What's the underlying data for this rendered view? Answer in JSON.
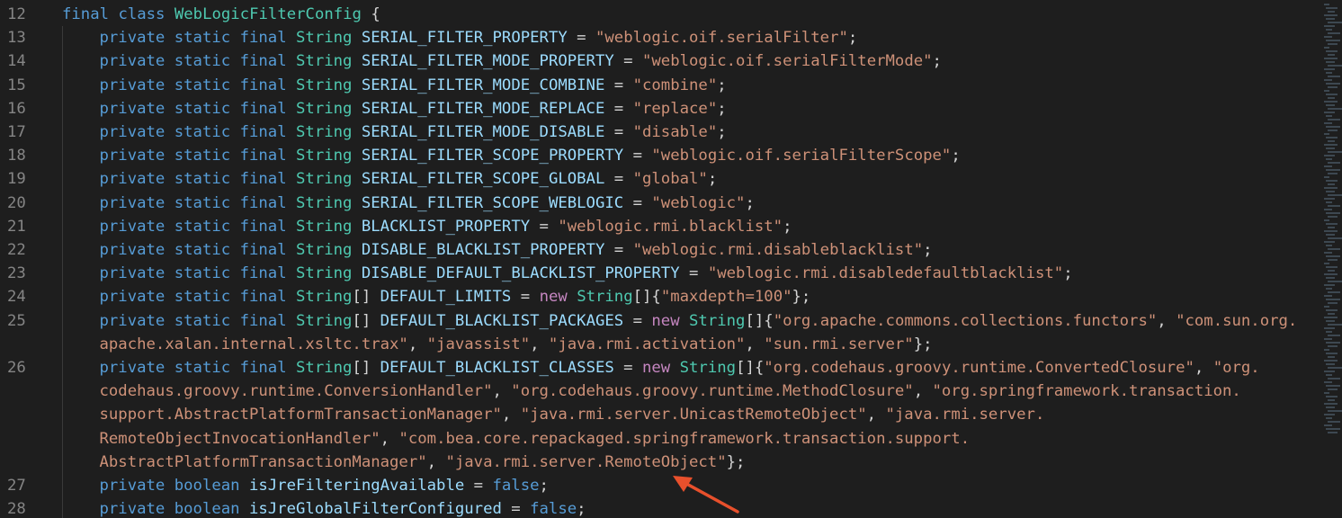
{
  "colors": {
    "background": "#1e1e1e",
    "keyword": "#569cd6",
    "type": "#4ec9b0",
    "string": "#ce9178",
    "identifier": "#9cdcfe",
    "new_keyword": "#c586c0",
    "arrow": "#e8502c"
  },
  "lines": [
    {
      "num": "12",
      "indent": 0,
      "tokens": [
        [
          "kw",
          "final "
        ],
        [
          "kw",
          "class "
        ],
        [
          "cl",
          "WebLogicFilterConfig"
        ],
        [
          "pn",
          " {"
        ]
      ]
    },
    {
      "num": "13",
      "indent": 1,
      "tokens": [
        [
          "kw",
          "private "
        ],
        [
          "kw",
          "static "
        ],
        [
          "kw",
          "final "
        ],
        [
          "ty",
          "String "
        ],
        [
          "id",
          "SERIAL_FILTER_PROPERTY"
        ],
        [
          "pn",
          " = "
        ],
        [
          "st",
          "\"weblogic.oif.serialFilter\""
        ],
        [
          "pn",
          ";"
        ]
      ]
    },
    {
      "num": "14",
      "indent": 1,
      "tokens": [
        [
          "kw",
          "private "
        ],
        [
          "kw",
          "static "
        ],
        [
          "kw",
          "final "
        ],
        [
          "ty",
          "String "
        ],
        [
          "id",
          "SERIAL_FILTER_MODE_PROPERTY"
        ],
        [
          "pn",
          " = "
        ],
        [
          "st",
          "\"weblogic.oif.serialFilterMode\""
        ],
        [
          "pn",
          ";"
        ]
      ]
    },
    {
      "num": "15",
      "indent": 1,
      "tokens": [
        [
          "kw",
          "private "
        ],
        [
          "kw",
          "static "
        ],
        [
          "kw",
          "final "
        ],
        [
          "ty",
          "String "
        ],
        [
          "id",
          "SERIAL_FILTER_MODE_COMBINE"
        ],
        [
          "pn",
          " = "
        ],
        [
          "st",
          "\"combine\""
        ],
        [
          "pn",
          ";"
        ]
      ]
    },
    {
      "num": "16",
      "indent": 1,
      "tokens": [
        [
          "kw",
          "private "
        ],
        [
          "kw",
          "static "
        ],
        [
          "kw",
          "final "
        ],
        [
          "ty",
          "String "
        ],
        [
          "id",
          "SERIAL_FILTER_MODE_REPLACE"
        ],
        [
          "pn",
          " = "
        ],
        [
          "st",
          "\"replace\""
        ],
        [
          "pn",
          ";"
        ]
      ]
    },
    {
      "num": "17",
      "indent": 1,
      "tokens": [
        [
          "kw",
          "private "
        ],
        [
          "kw",
          "static "
        ],
        [
          "kw",
          "final "
        ],
        [
          "ty",
          "String "
        ],
        [
          "id",
          "SERIAL_FILTER_MODE_DISABLE"
        ],
        [
          "pn",
          " = "
        ],
        [
          "st",
          "\"disable\""
        ],
        [
          "pn",
          ";"
        ]
      ]
    },
    {
      "num": "18",
      "indent": 1,
      "tokens": [
        [
          "kw",
          "private "
        ],
        [
          "kw",
          "static "
        ],
        [
          "kw",
          "final "
        ],
        [
          "ty",
          "String "
        ],
        [
          "id",
          "SERIAL_FILTER_SCOPE_PROPERTY"
        ],
        [
          "pn",
          " = "
        ],
        [
          "st",
          "\"weblogic.oif.serialFilterScope\""
        ],
        [
          "pn",
          ";"
        ]
      ]
    },
    {
      "num": "19",
      "indent": 1,
      "tokens": [
        [
          "kw",
          "private "
        ],
        [
          "kw",
          "static "
        ],
        [
          "kw",
          "final "
        ],
        [
          "ty",
          "String "
        ],
        [
          "id",
          "SERIAL_FILTER_SCOPE_GLOBAL"
        ],
        [
          "pn",
          " = "
        ],
        [
          "st",
          "\"global\""
        ],
        [
          "pn",
          ";"
        ]
      ]
    },
    {
      "num": "20",
      "indent": 1,
      "tokens": [
        [
          "kw",
          "private "
        ],
        [
          "kw",
          "static "
        ],
        [
          "kw",
          "final "
        ],
        [
          "ty",
          "String "
        ],
        [
          "id",
          "SERIAL_FILTER_SCOPE_WEBLOGIC"
        ],
        [
          "pn",
          " = "
        ],
        [
          "st",
          "\"weblogic\""
        ],
        [
          "pn",
          ";"
        ]
      ]
    },
    {
      "num": "21",
      "indent": 1,
      "tokens": [
        [
          "kw",
          "private "
        ],
        [
          "kw",
          "static "
        ],
        [
          "kw",
          "final "
        ],
        [
          "ty",
          "String "
        ],
        [
          "id",
          "BLACKLIST_PROPERTY"
        ],
        [
          "pn",
          " = "
        ],
        [
          "st",
          "\"weblogic.rmi.blacklist\""
        ],
        [
          "pn",
          ";"
        ]
      ]
    },
    {
      "num": "22",
      "indent": 1,
      "tokens": [
        [
          "kw",
          "private "
        ],
        [
          "kw",
          "static "
        ],
        [
          "kw",
          "final "
        ],
        [
          "ty",
          "String "
        ],
        [
          "id",
          "DISABLE_BLACKLIST_PROPERTY"
        ],
        [
          "pn",
          " = "
        ],
        [
          "st",
          "\"weblogic.rmi.disableblacklist\""
        ],
        [
          "pn",
          ";"
        ]
      ]
    },
    {
      "num": "23",
      "indent": 1,
      "tokens": [
        [
          "kw",
          "private "
        ],
        [
          "kw",
          "static "
        ],
        [
          "kw",
          "final "
        ],
        [
          "ty",
          "String "
        ],
        [
          "id",
          "DISABLE_DEFAULT_BLACKLIST_PROPERTY"
        ],
        [
          "pn",
          " = "
        ],
        [
          "st",
          "\"weblogic.rmi.disabledefaultblacklist\""
        ],
        [
          "pn",
          ";"
        ]
      ]
    },
    {
      "num": "24",
      "indent": 1,
      "tokens": [
        [
          "kw",
          "private "
        ],
        [
          "kw",
          "static "
        ],
        [
          "kw",
          "final "
        ],
        [
          "ty",
          "String"
        ],
        [
          "pn",
          "[] "
        ],
        [
          "id",
          "DEFAULT_LIMITS"
        ],
        [
          "pn",
          " = "
        ],
        [
          "nw",
          "new "
        ],
        [
          "ty",
          "String"
        ],
        [
          "pn",
          "[]{"
        ],
        [
          "st",
          "\"maxdepth=100\""
        ],
        [
          "pn",
          "};"
        ]
      ]
    },
    {
      "num": "25",
      "indent": 1,
      "tokens": [
        [
          "kw",
          "private "
        ],
        [
          "kw",
          "static "
        ],
        [
          "kw",
          "final "
        ],
        [
          "ty",
          "String"
        ],
        [
          "pn",
          "[] "
        ],
        [
          "id",
          "DEFAULT_BLACKLIST_PACKAGES"
        ],
        [
          "pn",
          " = "
        ],
        [
          "nw",
          "new "
        ],
        [
          "ty",
          "String"
        ],
        [
          "pn",
          "[]{"
        ],
        [
          "st",
          "\"org.apache.commons.collections.functors\""
        ],
        [
          "pn",
          ", "
        ],
        [
          "st",
          "\"com.sun.org."
        ]
      ]
    },
    {
      "num": "",
      "indent": 1,
      "tokens": [
        [
          "st",
          "apache.xalan.internal.xsltc.trax\""
        ],
        [
          "pn",
          ", "
        ],
        [
          "st",
          "\"javassist\""
        ],
        [
          "pn",
          ", "
        ],
        [
          "st",
          "\"java.rmi.activation\""
        ],
        [
          "pn",
          ", "
        ],
        [
          "st",
          "\"sun.rmi.server\""
        ],
        [
          "pn",
          "};"
        ]
      ]
    },
    {
      "num": "26",
      "indent": 1,
      "tokens": [
        [
          "kw",
          "private "
        ],
        [
          "kw",
          "static "
        ],
        [
          "kw",
          "final "
        ],
        [
          "ty",
          "String"
        ],
        [
          "pn",
          "[] "
        ],
        [
          "id",
          "DEFAULT_BLACKLIST_CLASSES"
        ],
        [
          "pn",
          " = "
        ],
        [
          "nw",
          "new "
        ],
        [
          "ty",
          "String"
        ],
        [
          "pn",
          "[]{"
        ],
        [
          "st",
          "\"org.codehaus.groovy.runtime.ConvertedClosure\""
        ],
        [
          "pn",
          ", "
        ],
        [
          "st",
          "\"org."
        ]
      ]
    },
    {
      "num": "",
      "indent": 1,
      "tokens": [
        [
          "st",
          "codehaus.groovy.runtime.ConversionHandler\""
        ],
        [
          "pn",
          ", "
        ],
        [
          "st",
          "\"org.codehaus.groovy.runtime.MethodClosure\""
        ],
        [
          "pn",
          ", "
        ],
        [
          "st",
          "\"org.springframework.transaction."
        ]
      ]
    },
    {
      "num": "",
      "indent": 1,
      "tokens": [
        [
          "st",
          "support.AbstractPlatformTransactionManager\""
        ],
        [
          "pn",
          ", "
        ],
        [
          "st",
          "\"java.rmi.server.UnicastRemoteObject\""
        ],
        [
          "pn",
          ", "
        ],
        [
          "st",
          "\"java.rmi.server."
        ]
      ]
    },
    {
      "num": "",
      "indent": 1,
      "tokens": [
        [
          "st",
          "RemoteObjectInvocationHandler\""
        ],
        [
          "pn",
          ", "
        ],
        [
          "st",
          "\"com.bea.core.repackaged.springframework.transaction.support."
        ]
      ]
    },
    {
      "num": "",
      "indent": 1,
      "tokens": [
        [
          "st",
          "AbstractPlatformTransactionManager\""
        ],
        [
          "pn",
          ", "
        ],
        [
          "st",
          "\"java.rmi.server.RemoteObject\""
        ],
        [
          "pn",
          "};"
        ]
      ]
    },
    {
      "num": "27",
      "indent": 1,
      "tokens": [
        [
          "kw",
          "private "
        ],
        [
          "kw",
          "boolean "
        ],
        [
          "id",
          "isJreFilteringAvailable"
        ],
        [
          "pn",
          " = "
        ],
        [
          "fl",
          "false"
        ],
        [
          "pn",
          ";"
        ]
      ]
    },
    {
      "num": "28",
      "indent": 1,
      "tokens": [
        [
          "kw",
          "private "
        ],
        [
          "kw",
          "boolean "
        ],
        [
          "id",
          "isJreGlobalFilterConfigured"
        ],
        [
          "pn",
          " = "
        ],
        [
          "fl",
          "false"
        ],
        [
          "pn",
          ";"
        ]
      ]
    }
  ]
}
